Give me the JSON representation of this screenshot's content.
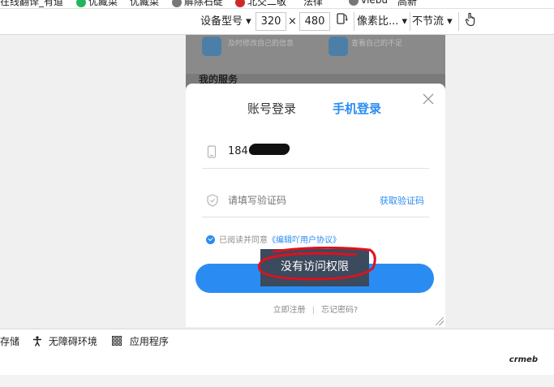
{
  "bookmarks": [
    {
      "label": "在线翻译_有道",
      "color": ""
    },
    {
      "label": "优藏菜",
      "color": "#22b45f"
    },
    {
      "label": "优藏菜",
      "color": ""
    },
    {
      "label": "解除石碇",
      "color": "#777777"
    },
    {
      "label": "北交二敬",
      "color": "#cc2a2a"
    },
    {
      "label": "法律",
      "color": ""
    },
    {
      "label": "vlebu",
      "color": "#777777"
    },
    {
      "label": "高新",
      "color": ""
    }
  ],
  "devtools": {
    "device_select": "设备型号 ▾",
    "width": "320",
    "times": "×",
    "height": "480",
    "pixel_ratio_select": "像素比... ▾",
    "throttle_select": "不节流 ▾"
  },
  "page": {
    "bg_items": [
      {
        "text": "及时修改自己的信息"
      },
      {
        "text": "查看自己的不足"
      }
    ],
    "section_title": "我的服务"
  },
  "login": {
    "tab_account": "账号登录",
    "tab_phone": "手机登录",
    "phone_value": "184",
    "code_placeholder": "请填写验证码",
    "get_code": "获取验证码",
    "agree_text": "已阅读并同意",
    "agree_link": "《编辑吖用户协议》",
    "login_button": "立即登录",
    "tooltip": "没有访问权限",
    "register": "立即注册",
    "separator": "|",
    "forgot": "忘记密码?"
  },
  "drawer": {
    "storage": "存储",
    "accessibility": "无障碍环境",
    "apps": "应用程序"
  },
  "brand": "crmeb",
  "colors": {
    "accent": "#2a8cf2",
    "marker": "#e0101e",
    "tooltip_bg": "#3b4a5c"
  }
}
